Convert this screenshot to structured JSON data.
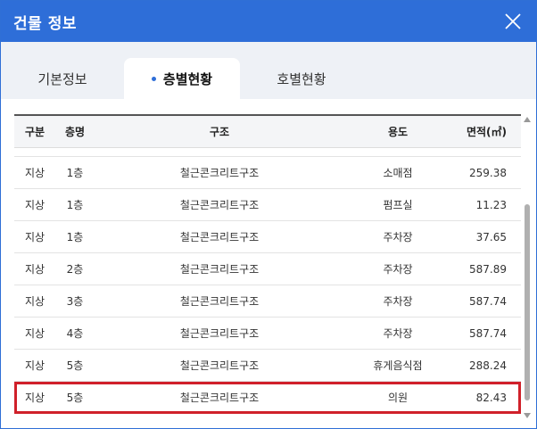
{
  "window": {
    "title": "건물 정보"
  },
  "tabs": [
    {
      "label": "기본정보"
    },
    {
      "label": "층별현황"
    },
    {
      "label": "호별현황"
    }
  ],
  "active_tab": 1,
  "accent_color": "#2e6ed8",
  "highlight_color": "#d0202a",
  "table": {
    "headers": [
      "구분",
      "층명",
      "구조",
      "용도",
      "면적(㎡)"
    ],
    "rows": [
      [
        "지상",
        "1층",
        "철근콘크리트구조",
        "소매점",
        "259.38"
      ],
      [
        "지상",
        "1층",
        "철근콘크리트구조",
        "펌프실",
        "11.23"
      ],
      [
        "지상",
        "1층",
        "철근콘크리트구조",
        "주차장",
        "37.65"
      ],
      [
        "지상",
        "2층",
        "철근콘크리트구조",
        "주차장",
        "587.89"
      ],
      [
        "지상",
        "3층",
        "철근콘크리트구조",
        "주차장",
        "587.74"
      ],
      [
        "지상",
        "4층",
        "철근콘크리트구조",
        "주차장",
        "587.74"
      ],
      [
        "지상",
        "5층",
        "철근콘크리트구조",
        "휴게음식점",
        "288.24"
      ],
      [
        "지상",
        "5층",
        "철근콘크리트구조",
        "의원",
        "82.43"
      ]
    ],
    "highlighted_row": 7
  }
}
